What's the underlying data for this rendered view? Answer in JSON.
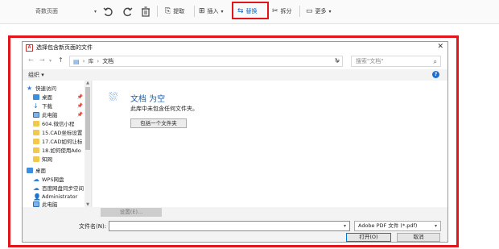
{
  "toolbar": {
    "page_select": "奇数页面",
    "icons": [
      "undo-icon",
      "redo-icon",
      "delete-icon"
    ],
    "extract_label": "提取",
    "insert_label": "插入",
    "replace_label": "替换",
    "split_label": "拆分",
    "more_label": "更多"
  },
  "dialog": {
    "title": "选择包含新页面的文件",
    "address": {
      "root": "库",
      "folder": "文档"
    },
    "search_placeholder": "搜索\"文档\"",
    "organize_label": "组织 ▾",
    "nav": {
      "quick_access": "快速访问",
      "desktop": "桌面",
      "downloads": "下载",
      "this_pc": "此电脑",
      "folder1": "604.微信小程",
      "folder2": "15.CAD坐标设置",
      "folder3": "17.CAD如何让标",
      "folder4": "18.如何使用Ado",
      "folder5": "知网",
      "desktop2": "桌面",
      "wps_cloud": "WPS网盘",
      "baidu": "百度网盘同步空间",
      "admin": "Administrator",
      "this_pc2": "此电脑"
    },
    "empty_title": "文档 为空",
    "empty_desc": "此库中未包含任何文件夹。",
    "include_folder": "包括一个文件夹",
    "settings": "设置(E)...",
    "filename_label": "文件名(N):",
    "filetype": "Adobe PDF 文件 (*.pdf)",
    "open": "打开(O)",
    "cancel": "取消"
  },
  "colors": {
    "highlight": "#e3151b",
    "accent": "#1565c0"
  }
}
